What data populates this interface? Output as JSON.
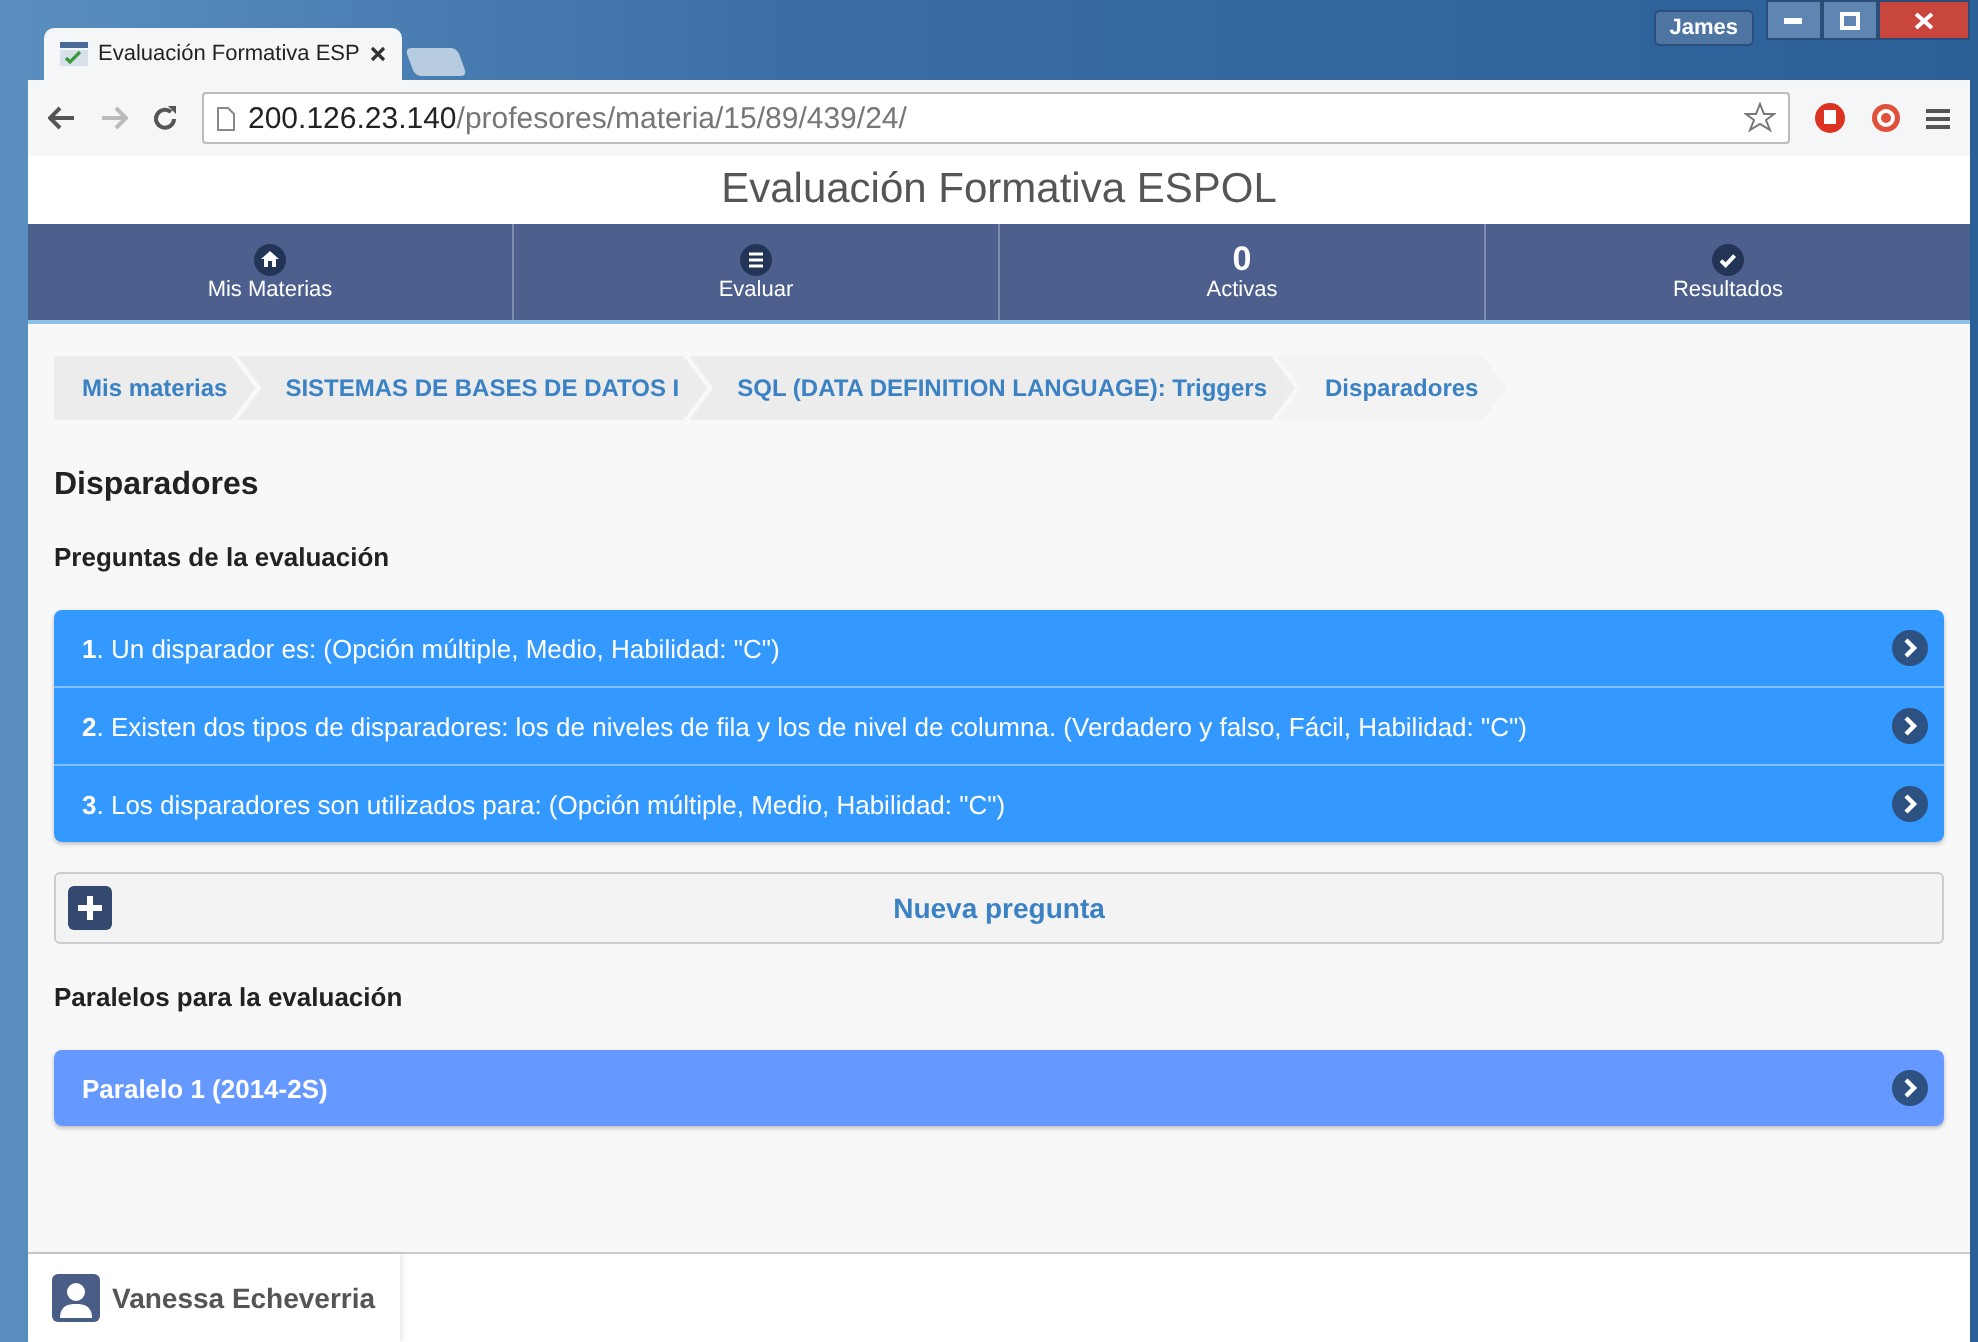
{
  "window": {
    "user": "James"
  },
  "browser": {
    "tab_title": "Evaluación Formativa ESP",
    "url_host": "200.126.23.140",
    "url_path": "/profesores/materia/15/89/439/24/"
  },
  "header": {
    "title": "Evaluación Formativa ESPOL"
  },
  "nav": [
    {
      "kind": "home",
      "label": "Mis Materias"
    },
    {
      "kind": "menu",
      "label": "Evaluar"
    },
    {
      "kind": "count",
      "count": "0",
      "label": "Activas"
    },
    {
      "kind": "check",
      "label": "Resultados"
    }
  ],
  "breadcrumb": [
    "Mis materias",
    "SISTEMAS DE BASES DE DATOS I",
    "SQL (DATA DEFINITION LANGUAGE): Triggers",
    "Disparadores"
  ],
  "page_title": "Disparadores",
  "questions_heading": "Preguntas de la evaluación",
  "questions": [
    "**1**. Un disparador es: (Opción múltiple, Medio, Habilidad: \"C\")",
    "**2**. Existen dos tipos de disparadores: los de niveles de fila y los de nivel de columna. (Verdadero y falso, Fácil, Habilidad: \"C\")",
    "**3**. Los disparadores son utilizados para: (Opción múltiple, Medio, Habilidad: \"C\")"
  ],
  "new_question": "Nueva pregunta",
  "groups_heading": "Paralelos para la evaluación",
  "groups": [
    "Paralelo 1 (2014-2S)"
  ],
  "footer": {
    "user": "Vanessa Echeverria"
  }
}
